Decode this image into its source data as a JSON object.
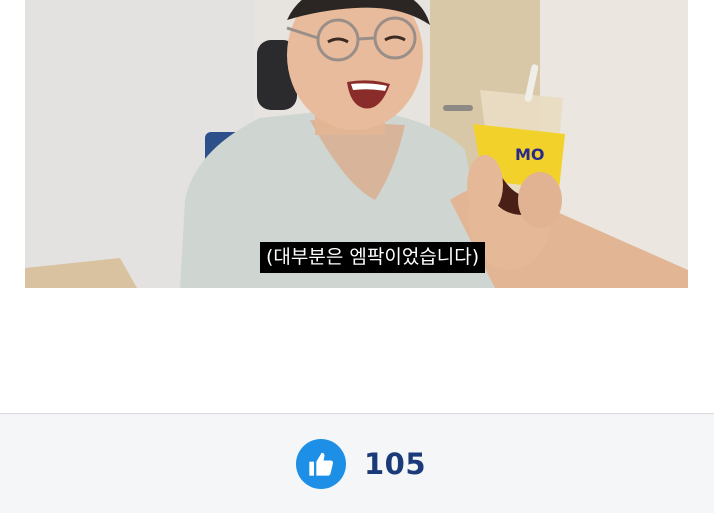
{
  "video": {
    "subtitle": "(대부분은 엠팍이었습니다)",
    "cup_label": "MO"
  },
  "reactions": {
    "like_icon": "thumbs-up-icon",
    "like_count": "105",
    "accent_color": "#1d8fe6",
    "count_color": "#1a3a7a"
  }
}
